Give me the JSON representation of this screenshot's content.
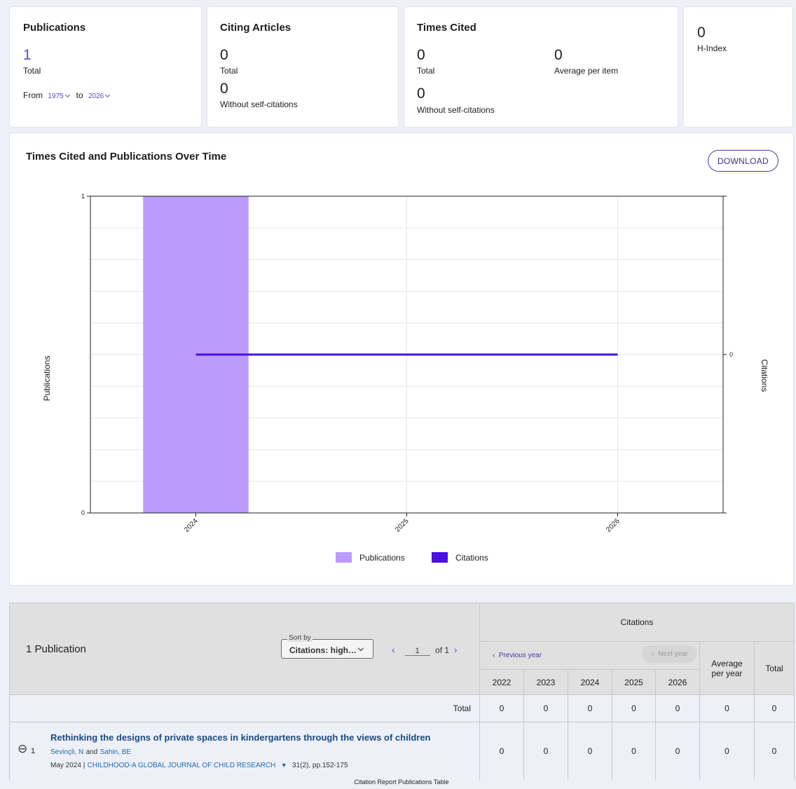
{
  "summary": {
    "publications": {
      "title": "Publications",
      "value": "1",
      "value_label": "Total",
      "from_label": "From",
      "from_year": "1975",
      "to_label": "to",
      "to_year": "2026"
    },
    "citing_articles": {
      "title": "Citing Articles",
      "total_value": "0",
      "total_label": "Total",
      "without_self_value": "0",
      "without_self_label": "Without self-citations"
    },
    "times_cited": {
      "title": "Times Cited",
      "total_value": "0",
      "total_label": "Total",
      "avg_value": "0",
      "avg_label": "Average per item",
      "without_self_value": "0",
      "without_self_label": "Without self-citations"
    },
    "h_index": {
      "value": "0",
      "label": "H-Index"
    }
  },
  "chart_section": {
    "title": "Times Cited and Publications Over Time",
    "download_label": "DOWNLOAD"
  },
  "chart_data": {
    "type": "bar",
    "categories": [
      "2024",
      "2025",
      "2026"
    ],
    "series": [
      {
        "name": "Publications",
        "kind": "bar",
        "axis": "left",
        "values": [
          1,
          0,
          0
        ],
        "color": "#bb9bfc"
      },
      {
        "name": "Citations",
        "kind": "line",
        "axis": "right",
        "values": [
          0,
          0,
          0
        ],
        "color": "#4b0fe0"
      }
    ],
    "ylabel": "Publications",
    "y2label": "Citations",
    "ylim": [
      0,
      1
    ],
    "y_ticks": [
      "0",
      "1"
    ],
    "y2_ticks": [
      "0"
    ],
    "grid": true,
    "legend_position": "bottom"
  },
  "table": {
    "count_label": "1 Publication",
    "sort_caption": "Sort by",
    "sort_value": "Citations: high…",
    "page_current": "1",
    "page_of": "of 1",
    "citations_header": "Citations",
    "prev_year": "Previous year",
    "next_year": "Next year",
    "years": [
      "2022",
      "2023",
      "2024",
      "2025",
      "2026"
    ],
    "avg_header": "Average per year",
    "total_header": "Total",
    "total_row_label": "Total",
    "total_row_values": [
      "0",
      "0",
      "0",
      "0",
      "0",
      "0",
      "0"
    ],
    "rows": [
      {
        "index": "1",
        "title": "Rethinking the designs of private spaces in kindergartens through the views of children",
        "author1": "Sevinçli, N",
        "and": "and",
        "author2": "Sahin, BE",
        "date": "May 2024 |",
        "journal": "CHILDHOOD-A GLOBAL JOURNAL OF CHILD RESEARCH",
        "volume": "31(2), pp.152-175",
        "values": [
          "0",
          "0",
          "0",
          "0",
          "0",
          "0",
          "0"
        ]
      }
    ],
    "caption": "Citation Report Publications Table"
  }
}
